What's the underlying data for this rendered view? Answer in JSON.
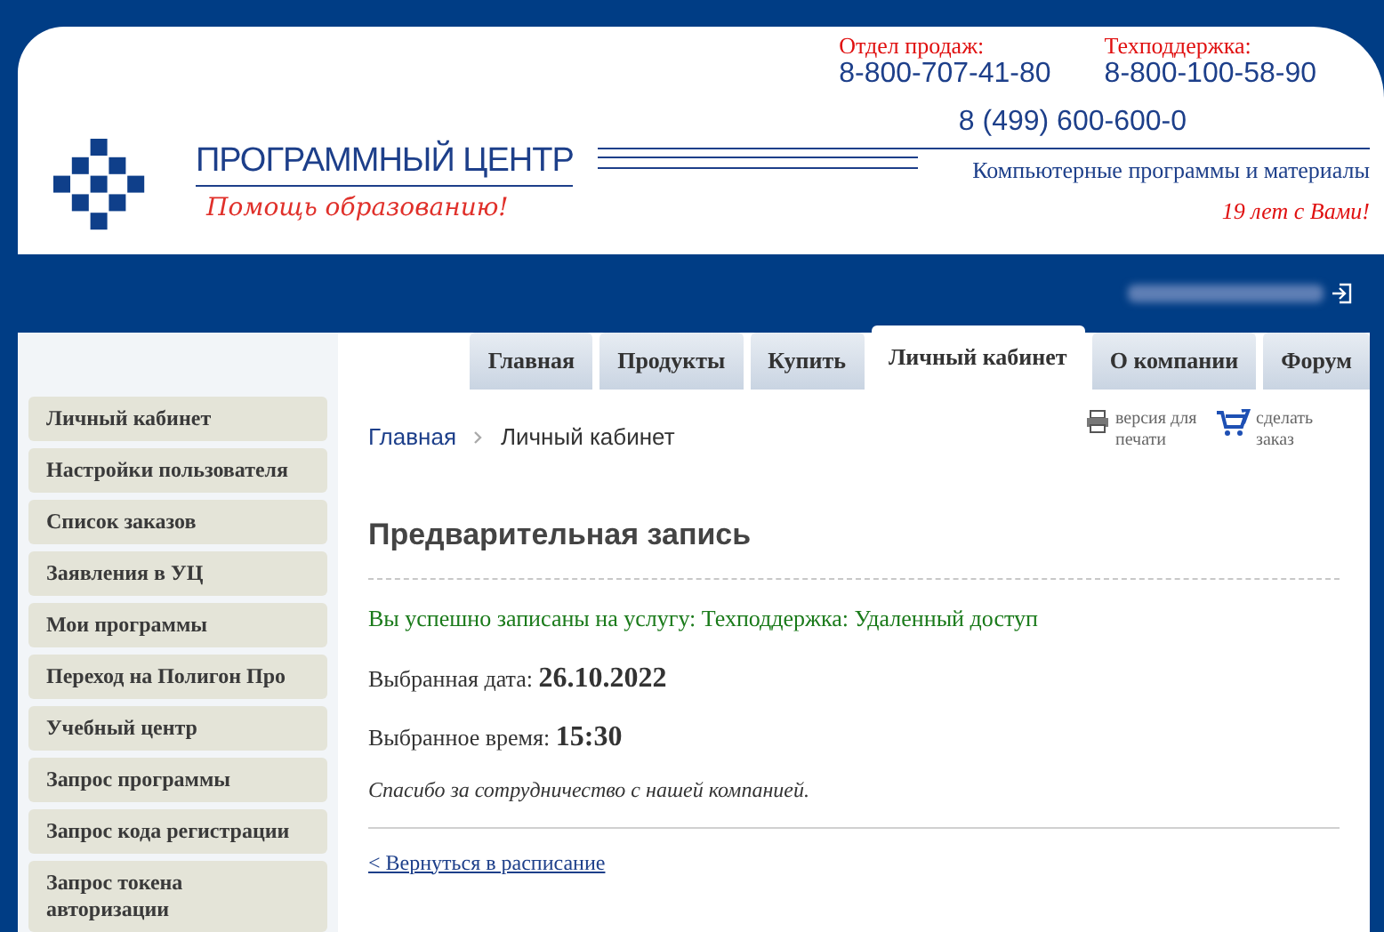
{
  "header": {
    "logo_title": "ПРОГРАММНЫЙ ЦЕНТР",
    "logo_slogan": "Помощь образованию!",
    "sales": {
      "label": "Отдел продаж:",
      "phone": "8-800-707-41-80"
    },
    "support": {
      "label": "Техподдержка:",
      "phone": "8-800-100-58-90"
    },
    "phone": "8 (499) 600-600-0",
    "tagline": "Компьютерные программы и материалы",
    "years": "19 лет с Вами!"
  },
  "tabs": [
    {
      "label": "Главная",
      "selected": false
    },
    {
      "label": "Продукты",
      "selected": false
    },
    {
      "label": "Купить",
      "selected": false
    },
    {
      "label": "Личный кабинет",
      "selected": true
    },
    {
      "label": "О компании",
      "selected": false
    },
    {
      "label": "Форум",
      "selected": false
    }
  ],
  "sidebar": {
    "items": [
      "Личный кабинет",
      "Настройки пользователя",
      "Список заказов",
      "Заявления в УЦ",
      "Мои программы",
      "Переход на Полигон Про",
      "Учебный центр",
      "Запрос программы",
      "Запрос кода регистрации",
      "Запрос токена авторизации"
    ]
  },
  "breadcrumbs": [
    "Главная",
    "Личный кабинет"
  ],
  "tools": [
    {
      "kind": "print",
      "label": "версия для печати"
    },
    {
      "kind": "cart",
      "label": "сделать заказ"
    }
  ],
  "content": {
    "title": "Предварительная запись",
    "success": "Вы успешно записаны на услугу: Техподдержка: Удаленный доступ",
    "date": "Выбранная дата: **26.10.2022**",
    "time": "Выбранное время: **15:30**",
    "thanks": "Спасибо за сотрудничество с нашей компанией.",
    "back_link": "< Вернуться в расписание"
  }
}
